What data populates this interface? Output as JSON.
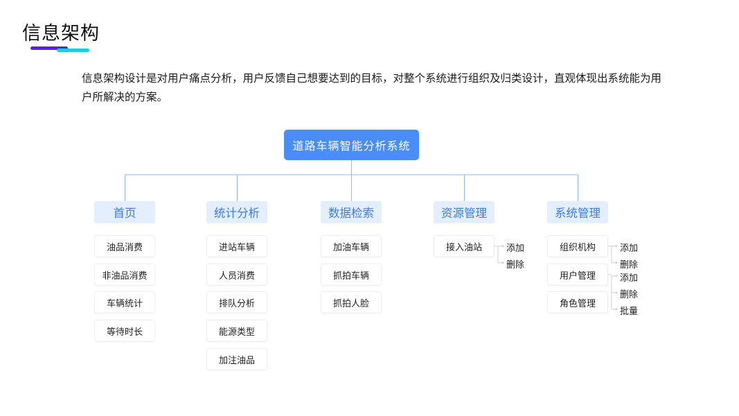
{
  "title": "信息架构",
  "intro": "信息架构设计是对用户痛点分析，用户反馈自己想要达到的目标，对整个系统进行组织及归类设计，直观体现出系统能为用户所解决的方案。",
  "root": "道路车辆智能分析系统",
  "categories": [
    {
      "label": "首页",
      "items": [
        "油品消费",
        "非油品消费",
        "车辆统计",
        "等待时长"
      ]
    },
    {
      "label": "统计分析",
      "items": [
        "进站车辆",
        "人员消费",
        "排队分析",
        "能源类型",
        "加注油品"
      ]
    },
    {
      "label": "数据检索",
      "items": [
        "加油车辆",
        "抓拍车辆",
        "抓拍人脸"
      ]
    },
    {
      "label": "资源管理",
      "items": [
        "接入油站"
      ],
      "subs": [
        [
          "添加",
          "删除"
        ]
      ]
    },
    {
      "label": "系统管理",
      "items": [
        "组织机构",
        "用户管理",
        "角色管理"
      ],
      "subs": [
        [
          "添加",
          "删除"
        ],
        [
          "添加",
          "删除",
          "批量"
        ]
      ]
    }
  ],
  "colors": {
    "accent": "#4b8df8",
    "category_bg": "#e3eefe",
    "category_text": "#3f7be8",
    "line": "#8fb6f7"
  }
}
